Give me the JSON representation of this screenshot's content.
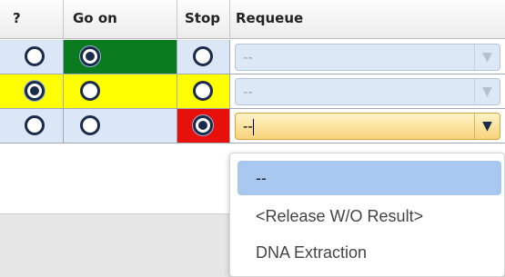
{
  "columns": [
    "?",
    "Go on",
    "Stop",
    "Requeue"
  ],
  "rows": [
    {
      "question": false,
      "go_on": true,
      "stop": false,
      "requeue_value": "--",
      "row_color": "#dbe7f6",
      "go_color": "#0a7a1e",
      "stop_color": "#dbe7f6",
      "q_color": "#dbe7f6"
    },
    {
      "question": true,
      "go_on": false,
      "stop": false,
      "requeue_value": "--",
      "row_color": "#ffff00",
      "go_color": "#ffff00",
      "stop_color": "#ffff00",
      "q_color": "#ffff00"
    },
    {
      "question": false,
      "go_on": false,
      "stop": true,
      "requeue_value": "--",
      "row_color": "#dbe7f6",
      "go_color": "#dbe7f6",
      "stop_color": "#e8100a",
      "q_color": "#dbe7f6"
    }
  ],
  "dropdown": {
    "options": [
      "--",
      "<Release W/O Result>",
      "DNA Extraction"
    ],
    "highlighted_index": 0
  },
  "icons": {
    "arrow": "chevron-down-icon"
  }
}
